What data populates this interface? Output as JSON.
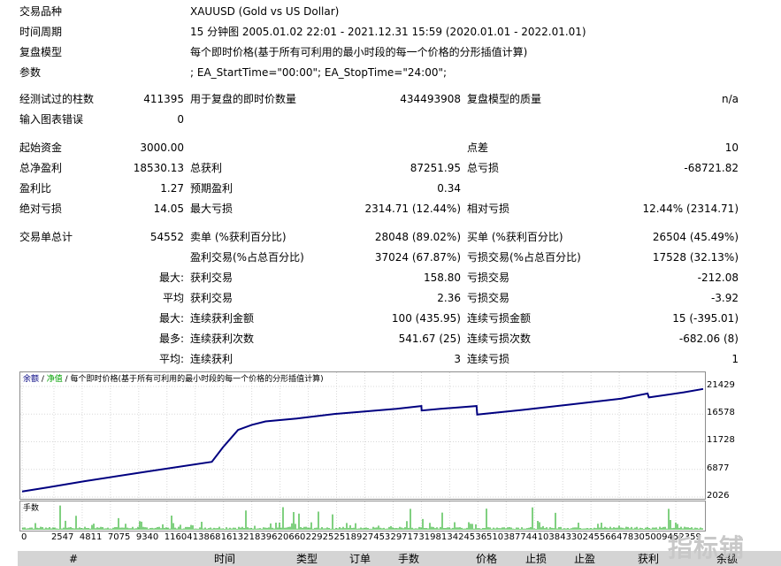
{
  "info": [
    {
      "label": "交易品种",
      "value": "XAUUSD (Gold vs US Dollar)"
    },
    {
      "label": "时间周期",
      "value": "15 分钟图 2005.01.02 22:01 - 2021.12.31 15:59 (2020.01.01 - 2022.01.01)"
    },
    {
      "label": "复盘模型",
      "value": "每个即时价格(基于所有可利用的最小时段的每一个价格的分形插值计算)"
    },
    {
      "label": "参数",
      "value": "; EA_StartTime=\"00:00\"; EA_StopTime=\"24:00\";"
    }
  ],
  "stats": {
    "bars_label": "经测试过的柱数",
    "bars": "411395",
    "ticks_label": "用于复盘的即时价数量",
    "ticks": "434493908",
    "quality_label": "复盘模型的质量",
    "quality": "n/a",
    "errors_label": "输入图表错误",
    "errors": "0",
    "deposit_label": "起始资金",
    "deposit": "3000.00",
    "spread_label": "点差",
    "spread": "10",
    "net_label": "总净盈利",
    "net": "18530.13",
    "gross_profit_label": "总获利",
    "gross_profit": "87251.95",
    "gross_loss_label": "总亏损",
    "gross_loss": "-68721.82",
    "pf_label": "盈利比",
    "pf": "1.27",
    "payoff_label": "预期盈利",
    "payoff": "0.34",
    "abs_dd_label": "绝对亏损",
    "abs_dd": "14.05",
    "max_dd_label": "最大亏损",
    "max_dd": "2314.71 (12.44%)",
    "rel_dd_label": "相对亏损",
    "rel_dd": "12.44% (2314.71)",
    "total_trades_label": "交易单总计",
    "total_trades": "54552",
    "short_label": "卖单 (%获利百分比)",
    "short": "28048 (89.02%)",
    "long_label": "买单 (%获利百分比)",
    "long": "26504 (45.49%)",
    "win_trades_label": "盈利交易(%占总百分比)",
    "win_trades": "37024 (67.87%)",
    "loss_trades_label": "亏损交易(%占总百分比)",
    "loss_trades": "17528 (32.13%)",
    "max_label": "最大:",
    "max_profit_label": "获利交易",
    "max_profit": "158.80",
    "max_loss_label": "亏损交易",
    "max_loss": "-212.08",
    "avg_label": "平均",
    "avg_profit_label": "获利交易",
    "avg_profit": "2.36",
    "avg_loss_label": "亏损交易",
    "avg_loss": "-3.92",
    "max2_label": "最大:",
    "cons_win_money_label": "连续获利金额",
    "cons_win_money": "100 (435.95)",
    "cons_loss_money_label": "连续亏损金额",
    "cons_loss_money": "15 (-395.01)",
    "most_label": "最多:",
    "cons_win_count_label": "连续获利次数",
    "cons_win_count": "541.67 (25)",
    "cons_loss_count_label": "连续亏损次数",
    "cons_loss_count": "-682.06 (8)",
    "avg2_label": "平均:",
    "avg_cons_win_label": "连续获利",
    "avg_cons_win": "3",
    "avg_cons_loss_label": "连续亏损",
    "avg_cons_loss": "1"
  },
  "chart": {
    "legend_balance": "余额",
    "legend_sep": " / ",
    "legend_equity": "净值",
    "legend_rest": " / 每个即时价格(基于所有可利用的最小时段的每一个价格的分形插值计算)",
    "volume_label": "手数",
    "line_color": "#000080",
    "volume_color": "#00a000"
  },
  "chart_data": {
    "type": "line",
    "yticks": [
      21429,
      16578,
      11728,
      6877,
      2026
    ],
    "ylim": [
      2026,
      21429
    ],
    "xticks": [
      0,
      2547,
      4811,
      7075,
      9340,
      11604,
      13868,
      16132,
      18396,
      20660,
      22925,
      25189,
      27453,
      29717,
      31981,
      34245,
      36510,
      38774,
      41038,
      43302,
      45566,
      47830,
      50094,
      52359
    ],
    "xlim": [
      0,
      54552
    ],
    "series": [
      {
        "x": [
          0,
          2000,
          5000,
          10000,
          15200,
          16100,
          17300,
          18400,
          19500,
          22000,
          25000,
          30000,
          31981,
          32000,
          33500,
          36400,
          36450,
          40000,
          44000,
          48000,
          50100,
          50200,
          53000,
          54552
        ],
        "y": [
          3000,
          3700,
          4800,
          6500,
          8200,
          10800,
          13800,
          14700,
          15300,
          15800,
          16600,
          17500,
          18000,
          17200,
          17500,
          18000,
          16500,
          17300,
          18300,
          19300,
          20200,
          19500,
          20400,
          21000
        ]
      }
    ]
  },
  "table_header": [
    "#",
    "时间",
    "类型",
    "订单",
    "手数",
    "价格",
    "止损",
    "止盈",
    "获利",
    "余额"
  ],
  "watermark": "指标铺"
}
